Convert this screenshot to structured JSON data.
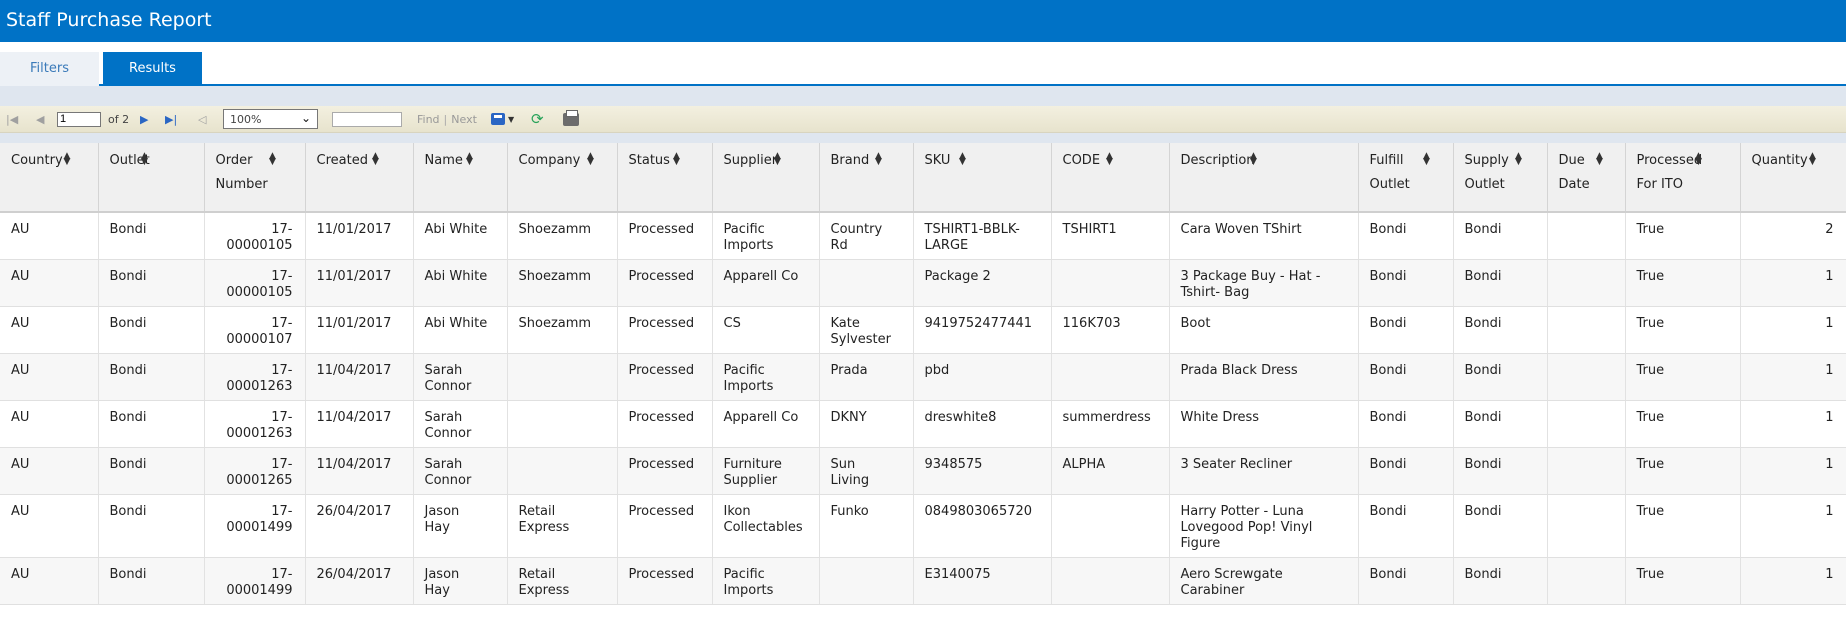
{
  "app": {
    "title": "Staff Purchase Report"
  },
  "tabs": {
    "filters": "Filters",
    "results": "Results"
  },
  "toolbar": {
    "page_value": "1",
    "page_of": "of 2",
    "zoom": "100%",
    "find": "Find",
    "sep": "|",
    "next": "Next"
  },
  "table": {
    "columns": [
      {
        "label": "Country",
        "label2": ""
      },
      {
        "label": "Outlet",
        "label2": ""
      },
      {
        "label": "Order",
        "label2": "Number"
      },
      {
        "label": "Created",
        "label2": ""
      },
      {
        "label": "Name",
        "label2": ""
      },
      {
        "label": "Company",
        "label2": ""
      },
      {
        "label": "Status",
        "label2": ""
      },
      {
        "label": "Supplier",
        "label2": ""
      },
      {
        "label": "Brand",
        "label2": ""
      },
      {
        "label": "SKU",
        "label2": ""
      },
      {
        "label": "CODE",
        "label2": ""
      },
      {
        "label": "Description",
        "label2": ""
      },
      {
        "label": "Fulfill",
        "label2": "Outlet"
      },
      {
        "label": "Supply",
        "label2": "Outlet"
      },
      {
        "label": "Due",
        "label2": "Date"
      },
      {
        "label": "Processed",
        "label2": "For ITO"
      },
      {
        "label": "Quantity",
        "label2": ""
      }
    ],
    "rows": [
      [
        "AU",
        "Bondi",
        "17-\n00000105",
        "11/01/2017",
        "Abi White",
        "Shoezamm",
        "Processed",
        "Pacific\nImports",
        "Country\nRd",
        "TSHIRT1-BBLK-\nLARGE",
        "TSHIRT1",
        "Cara Woven TShirt",
        "Bondi",
        "Bondi",
        "",
        "True",
        "2"
      ],
      [
        "AU",
        "Bondi",
        "17-\n00000105",
        "11/01/2017",
        "Abi White",
        "Shoezamm",
        "Processed",
        "Apparell Co",
        "",
        "Package 2",
        "",
        "3 Package Buy - Hat -\nTshirt- Bag",
        "Bondi",
        "Bondi",
        "",
        "True",
        "1"
      ],
      [
        "AU",
        "Bondi",
        "17-\n00000107",
        "11/01/2017",
        "Abi White",
        "Shoezamm",
        "Processed",
        "CS",
        "Kate\nSylvester",
        "9419752477441",
        "116K703",
        "Boot",
        "Bondi",
        "Bondi",
        "",
        "True",
        "1"
      ],
      [
        "AU",
        "Bondi",
        "17-\n00001263",
        "11/04/2017",
        "Sarah\nConnor",
        "",
        "Processed",
        "Pacific\nImports",
        "Prada",
        "pbd",
        "",
        "Prada Black Dress",
        "Bondi",
        "Bondi",
        "",
        "True",
        "1"
      ],
      [
        "AU",
        "Bondi",
        "17-\n00001263",
        "11/04/2017",
        "Sarah\nConnor",
        "",
        "Processed",
        "Apparell Co",
        "DKNY",
        "dreswhite8",
        "summerdress",
        "White Dress",
        "Bondi",
        "Bondi",
        "",
        "True",
        "1"
      ],
      [
        "AU",
        "Bondi",
        "17-\n00001265",
        "11/04/2017",
        "Sarah\nConnor",
        "",
        "Processed",
        "Furniture\nSupplier",
        "Sun\nLiving",
        "9348575",
        "ALPHA",
        "3 Seater Recliner",
        "Bondi",
        "Bondi",
        "",
        "True",
        "1"
      ],
      [
        "AU",
        "Bondi",
        "17-\n00001499",
        "26/04/2017",
        "Jason\nHay",
        "Retail\nExpress",
        "Processed",
        "Ikon\nCollectables",
        "Funko",
        "0849803065720",
        "",
        "Harry Potter - Luna\nLovegood Pop! Vinyl\nFigure",
        "Bondi",
        "Bondi",
        "",
        "True",
        "1"
      ],
      [
        "AU",
        "Bondi",
        "17-\n00001499",
        "26/04/2017",
        "Jason\nHay",
        "Retail\nExpress",
        "Processed",
        "Pacific\nImports",
        "",
        "E3140075",
        "",
        "Aero Screwgate\nCarabiner",
        "Bondi",
        "Bondi",
        "",
        "True",
        "1"
      ]
    ]
  }
}
